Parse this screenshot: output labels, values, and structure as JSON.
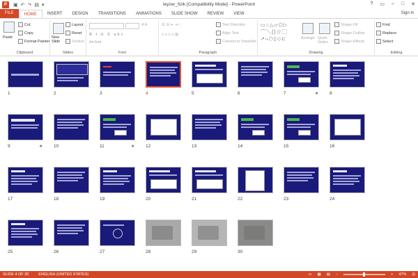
{
  "window": {
    "title": "leyzer_fizik [Compatibility Mode] - PowerPoint",
    "app_icon": "P",
    "controls": [
      "?",
      "▭",
      "–",
      "□",
      "✕"
    ]
  },
  "tabs": [
    "FILE",
    "HOME",
    "INSERT",
    "DESIGN",
    "TRANSITIONS",
    "ANIMATIONS",
    "SLIDE SHOW",
    "REVIEW",
    "VIEW"
  ],
  "active_tab": "HOME",
  "signin": "Sign in",
  "ribbon": {
    "clipboard": {
      "paste": "Paste",
      "cut": "Cut",
      "copy": "Copy",
      "format_painter": "Format Painter",
      "label": "Clipboard"
    },
    "slides": {
      "new_slide": "New Slide",
      "layout": "Layout",
      "reset": "Reset",
      "section": "Section",
      "label": "Slides"
    },
    "font": {
      "label": "Font"
    },
    "paragraph": {
      "text_direction": "Text Direction",
      "align_text": "Align Text",
      "convert_smartart": "Convert to SmartArt",
      "label": "Paragraph"
    },
    "drawing": {
      "arrange": "Arrange",
      "quick_styles": "Quick Styles",
      "shape_fill": "Shape Fill",
      "shape_outline": "Shape Outline",
      "shape_effects": "Shape Effects",
      "label": "Drawing"
    },
    "editing": {
      "find": "Find",
      "replace": "Replace",
      "select": "Select",
      "label": "Editing"
    }
  },
  "slides": [
    {
      "n": "1",
      "kind": "title",
      "star": false
    },
    {
      "n": "2",
      "kind": "boxed",
      "star": false
    },
    {
      "n": "3",
      "kind": "redtitle",
      "star": false
    },
    {
      "n": "4",
      "kind": "text",
      "star": false,
      "selected": true
    },
    {
      "n": "5",
      "kind": "diagram",
      "star": false
    },
    {
      "n": "6",
      "kind": "text2",
      "star": false
    },
    {
      "n": "7",
      "kind": "green",
      "star": true
    },
    {
      "n": "8",
      "kind": "list",
      "star": false
    },
    {
      "n": "9",
      "kind": "header",
      "star": true
    },
    {
      "n": "10",
      "kind": "text",
      "star": false
    },
    {
      "n": "11",
      "kind": "green",
      "star": true
    },
    {
      "n": "12",
      "kind": "whitepanel",
      "star": false
    },
    {
      "n": "13",
      "kind": "text",
      "star": false
    },
    {
      "n": "14",
      "kind": "green2",
      "star": false
    },
    {
      "n": "15",
      "kind": "green",
      "star": false
    },
    {
      "n": "16",
      "kind": "whitepanel2",
      "star": false
    },
    {
      "n": "17",
      "kind": "list",
      "star": false
    },
    {
      "n": "18",
      "kind": "text2",
      "star": false
    },
    {
      "n": "19",
      "kind": "list",
      "star": false
    },
    {
      "n": "20",
      "kind": "diagram",
      "star": false
    },
    {
      "n": "21",
      "kind": "diagram2",
      "star": false
    },
    {
      "n": "22",
      "kind": "sketch",
      "star": false
    },
    {
      "n": "23",
      "kind": "text",
      "star": false
    },
    {
      "n": "24",
      "kind": "list",
      "star": false
    },
    {
      "n": "25",
      "kind": "list",
      "star": false
    },
    {
      "n": "26",
      "kind": "text2",
      "star": false
    },
    {
      "n": "27",
      "kind": "circle",
      "star": false
    },
    {
      "n": "28",
      "kind": "photo",
      "star": false
    },
    {
      "n": "29",
      "kind": "photo2",
      "star": false
    },
    {
      "n": "30",
      "kind": "photo3",
      "star": false
    }
  ],
  "status": {
    "slide": "SLIDE 4 OF 30",
    "language": "ENGLISH (UNITED STATES)",
    "zoom": "47%"
  }
}
